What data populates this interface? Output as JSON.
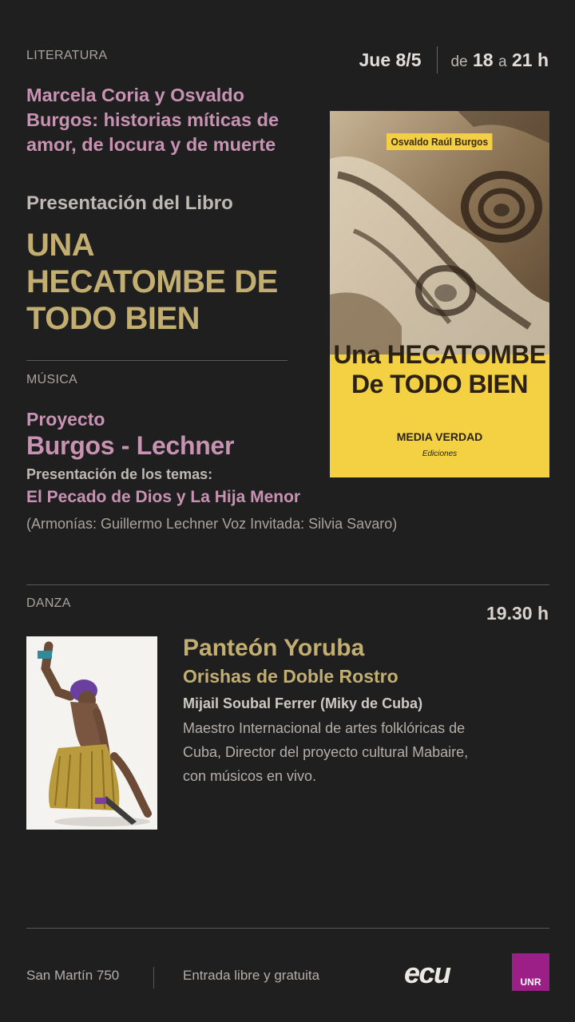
{
  "literature": {
    "section_label": "LITERATURA",
    "subtitle": "Marcela Coria y Osvaldo Burgos: historias míticas de amor, de locura y de muerte",
    "presentation": "Presentación del Libro",
    "book_title": "UNA HECATOMBE DE TODO BIEN"
  },
  "schedule": {
    "date": "Jue 8/5",
    "from_word": "de",
    "from_hour": "18",
    "to_word": "a",
    "to_hour": "21 h"
  },
  "book_cover": {
    "author": "Osvaldo Raúl Burgos",
    "title_line1": "Una HECATOMBE",
    "title_line2": "De TODO BIEN",
    "publisher": "MEDIA VERDAD",
    "editions": "Ediciones"
  },
  "music": {
    "section_label": "MÚSICA",
    "pre_title": "Proyecto",
    "name": "Burgos - Lechner",
    "intro": "Presentación de los temas:",
    "songs": "El Pecado de Dios y La Hija Menor",
    "credits": "(Armonías: Guillermo Lechner Voz Invitada: Silvia Savaro)"
  },
  "dance": {
    "section_label": "DANZA",
    "time": "19.30 h",
    "title": "Panteón Yoruba",
    "subtitle": "Orishas de Doble Rostro",
    "artist": "Mijail Soubal Ferrer (Miky de Cuba)",
    "description": "Maestro Internacional de artes folklóricas de Cuba, Director del proyecto cultural Mabaire, con músicos en vivo."
  },
  "footer": {
    "address": "San Martín 750",
    "entry": "Entrada libre y gratuita",
    "logo_ecu": "ecu",
    "logo_unr": "UNR"
  },
  "colors": {
    "background": "#201f20",
    "pink": "#c892b2",
    "gold": "#c3ae72",
    "unr_magenta": "#9b1f86",
    "cover_yellow": "#f3d142"
  }
}
